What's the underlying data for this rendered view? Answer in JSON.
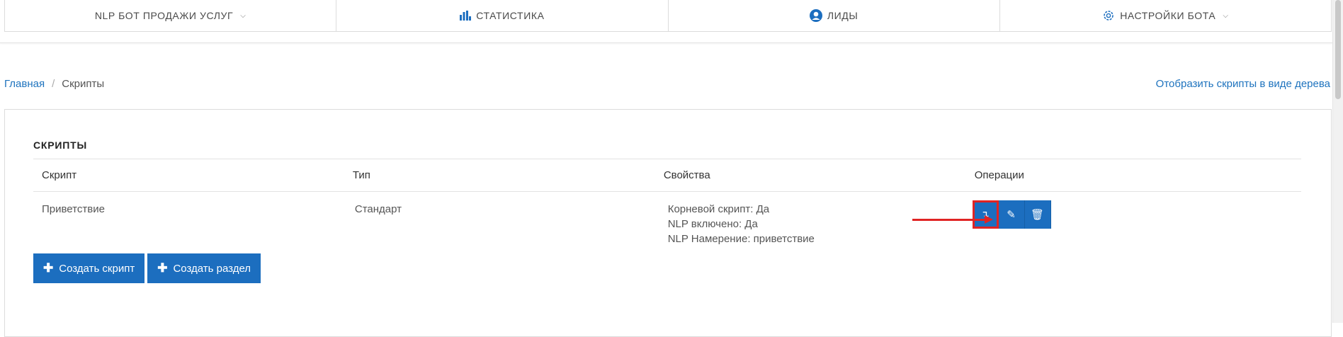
{
  "nav": {
    "items": [
      {
        "label": "NLP БОТ ПРОДАЖИ УСЛУГ",
        "icon": "chevron-down-icon"
      },
      {
        "label": "СТАТИСТИКА",
        "icon": "bar-chart-icon"
      },
      {
        "label": "ЛИДЫ",
        "icon": "user-icon"
      },
      {
        "label": "НАСТРОЙКИ БОТА",
        "icon": "gear-icon"
      }
    ]
  },
  "breadcrumb": {
    "home": "Главная",
    "separator": "/",
    "current": "Скрипты"
  },
  "tree_link": "Отобразить скрипты в виде дерева",
  "panel": {
    "title": "СКРИПТЫ",
    "columns": [
      "Скрипт",
      "Тип",
      "Свойства",
      "Операции"
    ],
    "rows": [
      {
        "script": "Приветствие",
        "type": "Стандарт",
        "properties": [
          "Корневой скрипт: Да",
          "NLP включено: Да",
          "NLP Намерение: приветствие"
        ]
      }
    ],
    "operations": {
      "move": "↴",
      "edit": "✎",
      "delete": "🗑"
    }
  },
  "actions": {
    "create_script": "Создать скрипт",
    "create_section": "Создать раздел",
    "plus": "✚"
  },
  "colors": {
    "accent": "#1c6ebf",
    "link": "#1e73be",
    "highlight": "#e02424"
  }
}
